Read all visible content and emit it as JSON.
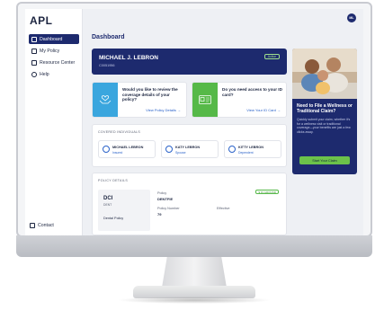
{
  "app": {
    "logo": "APL",
    "avatar_initials": "ML"
  },
  "sidebar": {
    "items": [
      {
        "label": "Dashboard",
        "active": true
      },
      {
        "label": "My Policy",
        "active": false
      },
      {
        "label": "Resource Center",
        "active": false
      },
      {
        "label": "Help",
        "active": false
      }
    ],
    "contact_label": "Contact"
  },
  "main": {
    "title": "Dashboard",
    "member": {
      "name": "MICHAEL J. LEBRON",
      "id": "C0051956",
      "status": "Active"
    },
    "cards": [
      {
        "question": "Would you like to review the coverage details of your policy?",
        "link": "View Policy Details →"
      },
      {
        "question": "Do you need access to your ID card?",
        "link": "View Your ID Card →"
      }
    ],
    "covered": {
      "title": "COVERED INDIVIDUALS",
      "people": [
        {
          "name": "MICHAEL LEBRON",
          "relation": "Insured"
        },
        {
          "name": "KATY LEBRON",
          "relation": "Spouse"
        },
        {
          "name": "KITTY LEBRON",
          "relation": "Dependent"
        }
      ]
    },
    "policy": {
      "title": "POLICY DETAILS",
      "code": "DCI",
      "sub": "DENT",
      "type": "Dental Policy",
      "policy_label": "Policy",
      "policy_value": "DENTFIE",
      "number_label": "Policy Number",
      "number_value": "79",
      "effective_label": "Effective",
      "status": "$ IN GROUND"
    }
  },
  "promo": {
    "title": "Need to File a Wellness or Traditional Claim?",
    "body": "Quickly submit your claim, whether it's for a wellness visit or traditional coverage—your benefits are just a few clicks away.",
    "button": "Start Your Claim"
  },
  "colors": {
    "navy": "#1d2a6e",
    "blue": "#3aa6de",
    "green": "#56b948",
    "link": "#2a62c9"
  },
  "icons": [
    "dashboard-icon",
    "policy-icon",
    "resource-icon",
    "help-icon",
    "contact-icon",
    "hands-heart-icon",
    "id-card-icon",
    "person-icon"
  ]
}
